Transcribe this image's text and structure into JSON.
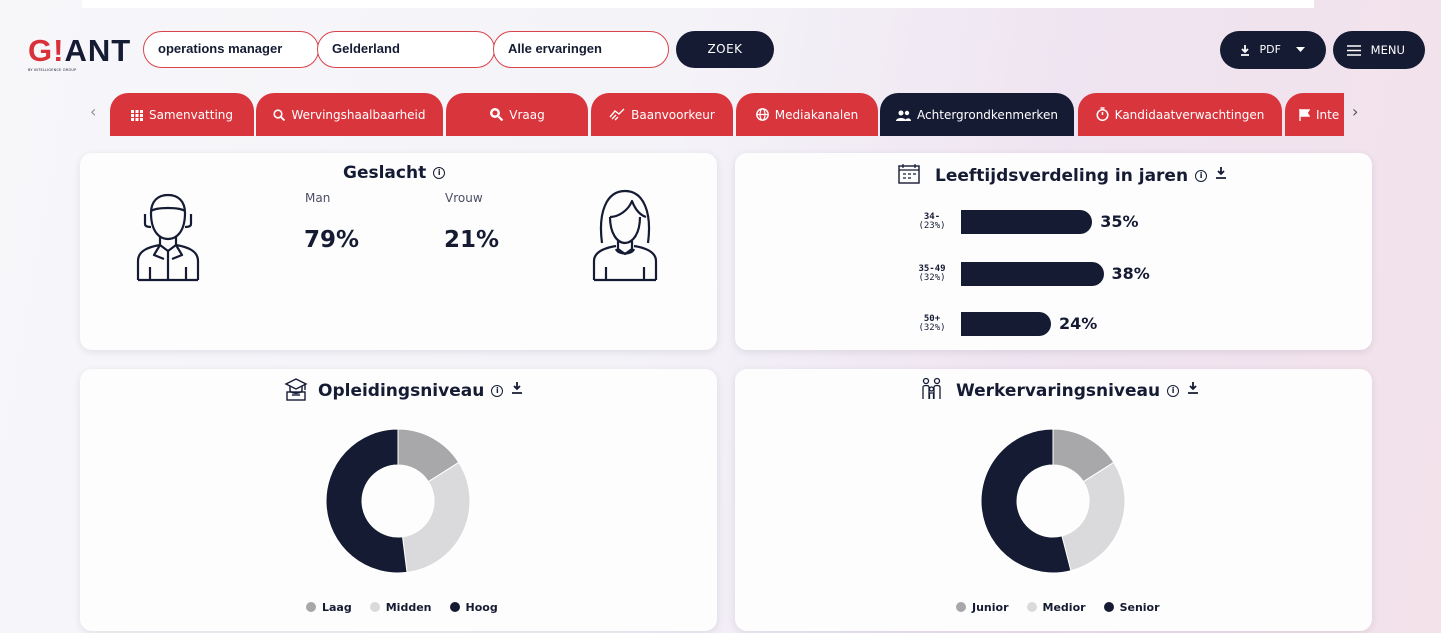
{
  "header": {
    "logo_text": "GIANT",
    "logo_sub": "BY INTELLIGENCE GROUP",
    "search_job": "operations manager",
    "search_region": "Gelderland",
    "search_experience": "Alle ervaringen",
    "search_button": "ZOEK",
    "pdf_button": "PDF",
    "menu_button": "MENU"
  },
  "tabs": [
    {
      "label": "Samenvatting",
      "icon": "grid-icon"
    },
    {
      "label": "Wervingshaalbaarheid",
      "icon": "search-icon"
    },
    {
      "label": "Vraag",
      "icon": "magnifier-icon"
    },
    {
      "label": "Baanvoorkeur",
      "icon": "handshake-icon"
    },
    {
      "label": "Mediakanalen",
      "icon": "globe-icon"
    },
    {
      "label": "Achtergrondkenmerken",
      "icon": "people-icon",
      "active": true
    },
    {
      "label": "Kandidaatverwachtingen",
      "icon": "timer-icon"
    },
    {
      "label": "Inte",
      "icon": "flag-icon"
    }
  ],
  "gender": {
    "title": "Geslacht",
    "man_label": "Man",
    "woman_label": "Vrouw",
    "man_value": "79%",
    "woman_value": "21%"
  },
  "age": {
    "title": "Leeftijdsverdeling in jaren",
    "rows": [
      {
        "group": "34-",
        "share": "(23%)",
        "value": 35,
        "label": "35%"
      },
      {
        "group": "35-49",
        "share": "(32%)",
        "value": 38,
        "label": "38%"
      },
      {
        "group": "50+",
        "share": "(32%)",
        "value": 24,
        "label": "24%"
      }
    ]
  },
  "education": {
    "title": "Opleidingsniveau",
    "legend": [
      "Laag",
      "Midden",
      "Hoog"
    ]
  },
  "experience": {
    "title": "Werkervaringsniveau",
    "legend": [
      "Junior",
      "Medior",
      "Senior"
    ]
  },
  "chart_data": [
    {
      "type": "bar",
      "title": "Leeftijdsverdeling in jaren",
      "categories": [
        "34- (23%)",
        "35-49 (32%)",
        "50+ (32%)"
      ],
      "values": [
        35,
        38,
        24
      ],
      "orientation": "horizontal"
    },
    {
      "type": "pie",
      "title": "Opleidingsniveau",
      "categories": [
        "Laag",
        "Midden",
        "Hoog"
      ],
      "values": [
        16,
        32,
        52
      ],
      "colors": [
        "#a8a8ab",
        "#dadadc",
        "#151b33"
      ]
    },
    {
      "type": "pie",
      "title": "Werkervaringsniveau",
      "categories": [
        "Junior",
        "Medior",
        "Senior"
      ],
      "values": [
        16,
        30,
        54
      ],
      "colors": [
        "#a8a8ab",
        "#dadadc",
        "#151b33"
      ]
    }
  ],
  "colors": {
    "navy": "#151b33",
    "red": "#d9353d",
    "grey_dark": "#a8a8ab",
    "grey_light": "#dadadc"
  }
}
